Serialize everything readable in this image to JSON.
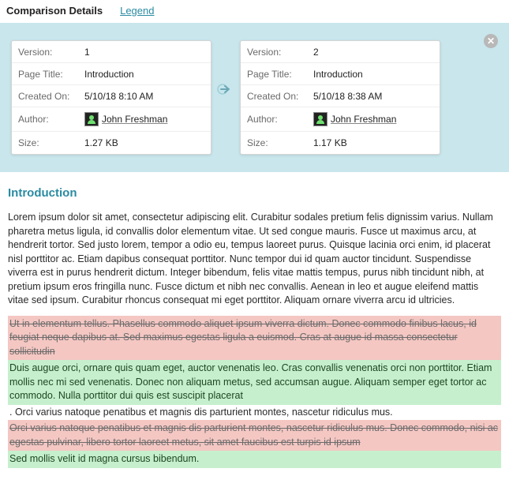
{
  "tabs": {
    "active": "Comparison Details",
    "inactive": "Legend"
  },
  "labels": {
    "version": "Version:",
    "pageTitle": "Page Title:",
    "createdOn": "Created On:",
    "author": "Author:",
    "size": "Size:"
  },
  "left": {
    "version": "1",
    "pageTitle": "Introduction",
    "createdOn": "5/10/18 8:10 AM",
    "author": "John Freshman",
    "size": "1.27 KB"
  },
  "right": {
    "version": "2",
    "pageTitle": "Introduction",
    "createdOn": "5/10/18 8:38 AM",
    "author": "John Freshman",
    "size": "1.17 KB"
  },
  "document": {
    "title": "Introduction",
    "para1": "Lorem ipsum dolor sit amet, consectetur adipiscing elit. Curabitur sodales pretium felis dignissim varius. Nullam pharetra metus ligula, id convallis dolor elementum vitae. Ut sed congue mauris. Fusce ut maximus arcu, at hendrerit tortor. Sed justo lorem, tempor a odio eu, tempus laoreet purus. Quisque lacinia orci enim, id placerat nisl porttitor ac. Etiam dapibus consequat porttitor. Nunc tempor dui id quam auctor tincidunt. Suspendisse viverra est in purus hendrerit dictum. Integer bibendum, felis vitae mattis tempus, purus nibh tincidunt nibh, at pretium ipsum eros fringilla nunc. Fusce dictum et nibh nec convallis. Aenean in leo et augue eleifend mattis vitae sed ipsum. Curabitur rhoncus consequat mi eget porttitor. Aliquam ornare viverra arcu id ultricies.",
    "deleted1": "Ut in elementum tellus. Phasellus commodo aliquet ipsum viverra dictum. Donec commodo finibus lacus, id feugiat neque dapibus at. Sed maximus egestas ligula a euismod. Cras at augue id massa consectetur sollicitudin",
    "added1": "Duis augue orci, ornare quis quam eget, auctor venenatis leo. Cras convallis venenatis orci non porttitor. Etiam mollis nec mi sed venenatis. Donec non aliquam metus, sed accumsan augue. Aliquam semper eget tortor ac commodo. Nulla porttitor dui quis est suscipit placerat",
    "unchanged1": ". Orci varius natoque penatibus et magnis dis parturient montes, nascetur ridiculus mus.",
    "deleted2": "Orci varius natoque penatibus et magnis dis parturient montes, nascetur ridiculus mus. Donec commodo, nisi ac egestas pulvinar, libero tortor laoreet metus, sit amet faucibus est turpis id ipsum",
    "added2": "Sed mollis velit id magna cursus bibendum."
  }
}
